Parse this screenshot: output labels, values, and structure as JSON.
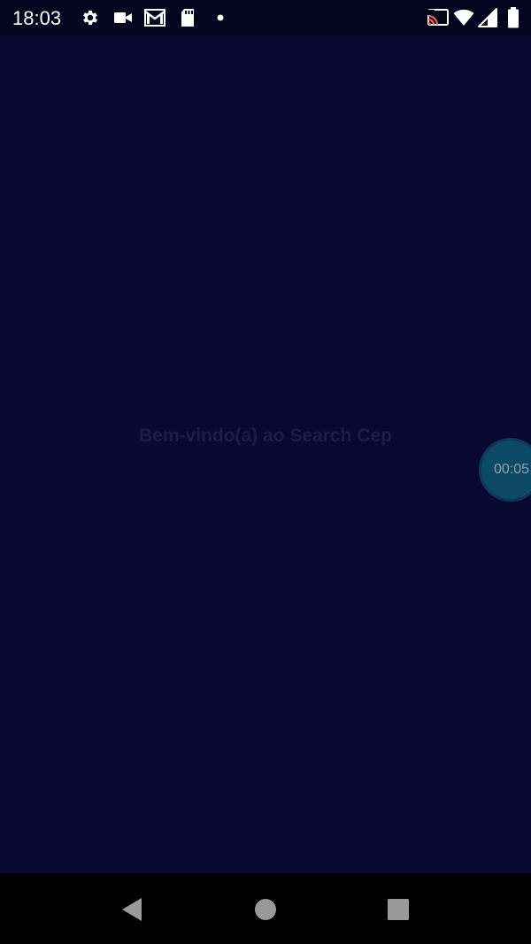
{
  "status_bar": {
    "time": "18:03",
    "left_icons": [
      "gear-icon",
      "video-camera-icon",
      "gmail-icon",
      "sd-card-icon",
      "dot-icon"
    ],
    "right_icons": [
      "cast-icon",
      "wifi-icon",
      "cell-signal-icon",
      "battery-icon"
    ]
  },
  "main": {
    "welcome": "Bem-vindo(a) ao Search Cep"
  },
  "timer": {
    "label": "00:05"
  },
  "nav_bar": {
    "buttons": [
      "back-icon",
      "home-icon",
      "recents-icon"
    ]
  },
  "colors": {
    "background": "#080830",
    "status_bar": "#05051f",
    "welcome_text": "#1c1c4a",
    "timer_fill": "#0b4a62",
    "nav_bar": "#000000"
  }
}
